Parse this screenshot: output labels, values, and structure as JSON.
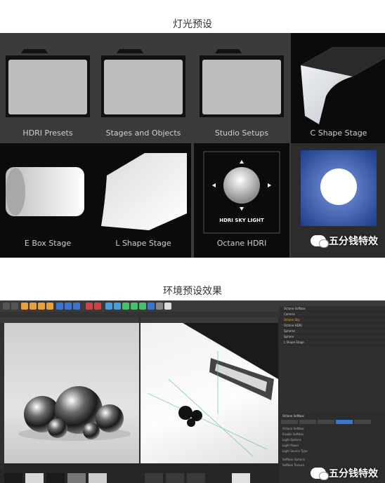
{
  "section1": {
    "title": "灯光预设"
  },
  "presets": [
    {
      "label": "HDRI Presets"
    },
    {
      "label": "Stages and Objects"
    },
    {
      "label": "Studio Setups"
    },
    {
      "label": "C Shape Stage"
    },
    {
      "label": "E Box Stage"
    },
    {
      "label": "L Shape Stage"
    },
    {
      "label": "Octane HDRI"
    }
  ],
  "octane_thumb_text": "HDRI SKY LIGHT",
  "watermark": "五分钱特效",
  "section2": {
    "title": "环境预设效果"
  },
  "c4d": {
    "objects": [
      "Octane Softbox",
      "Camera",
      "Octane Sky",
      "Octane HDRI",
      "Spheres",
      "Sphere",
      "L Shape Stage"
    ],
    "attr_title": "Octane Softbox",
    "attr_tabs": [
      "Basic",
      "Coord.",
      "Object",
      "Softbox",
      "Target"
    ],
    "attr_lines": [
      "Octane Softbox",
      "Enable Softbox",
      "Light Options",
      "Light Power",
      "Light Source Type",
      "Softbox Options",
      "Softbox Texture"
    ]
  },
  "colors": {
    "accent": "#3a76d0",
    "panel": "#3b3b3b"
  }
}
